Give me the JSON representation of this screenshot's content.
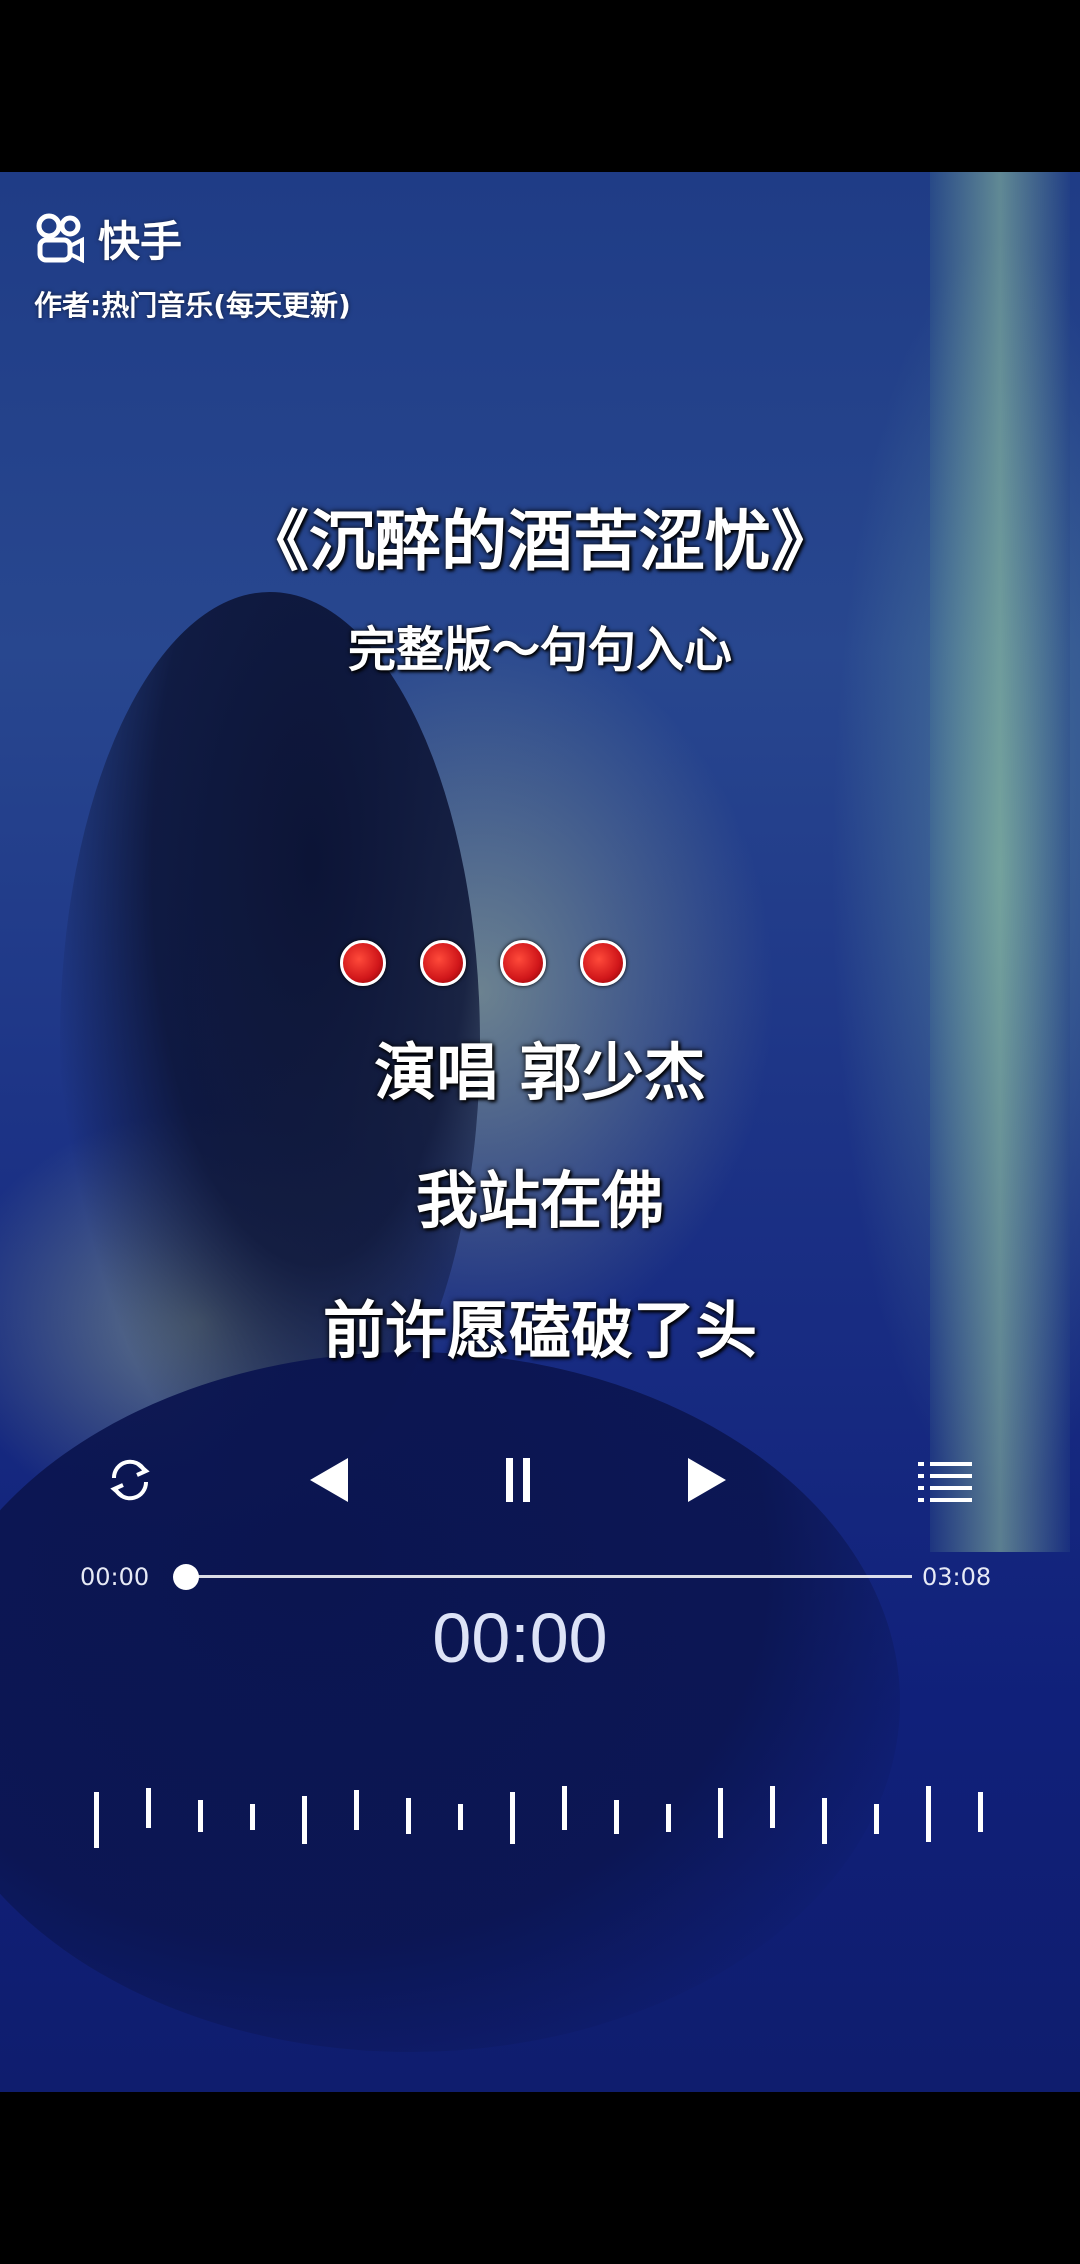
{
  "app": {
    "logo_name": "快手",
    "author": "作者:热门音乐(每天更新)"
  },
  "song": {
    "title": "《沉醉的酒苦涩忧》",
    "subtitle": "完整版～句句入心"
  },
  "lyrics": {
    "line1": "演唱 郭少杰",
    "line2": "我站在佛",
    "line3": "前许愿磕破了头"
  },
  "player": {
    "current_time": "00:00",
    "total_time": "03:08",
    "big_time": "00:00",
    "progress_fraction": 0.0,
    "controls": [
      "repeat-icon",
      "previous-icon",
      "pause-icon",
      "next-icon",
      "playlist-icon"
    ]
  },
  "colors": {
    "dot_red": "#d0161a",
    "background_blue": "#1a2f84"
  }
}
